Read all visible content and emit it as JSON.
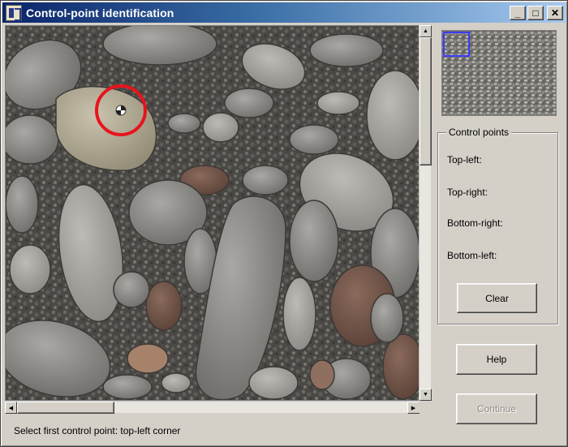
{
  "window": {
    "title": "Control-point identification",
    "minimize_glyph": "_",
    "maximize_glyph": "□",
    "close_glyph": "✕"
  },
  "viewport": {
    "scroll": {
      "up": "▲",
      "down": "▼",
      "left": "◀",
      "right": "▶"
    }
  },
  "control_points": {
    "group_title": "Control points",
    "labels": [
      "Top-left:",
      "Top-right:",
      "Bottom-right:",
      "Bottom-left:"
    ]
  },
  "buttons": {
    "clear": "Clear",
    "help": "Help",
    "continue": "Continue"
  },
  "status": {
    "message": "Select first control point: top-left corner"
  },
  "colors": {
    "marker": "#e8141c",
    "thumbnail_frame": "#3a3aff",
    "titlebar_start": "#0a246a",
    "titlebar_end": "#a6caf0"
  }
}
